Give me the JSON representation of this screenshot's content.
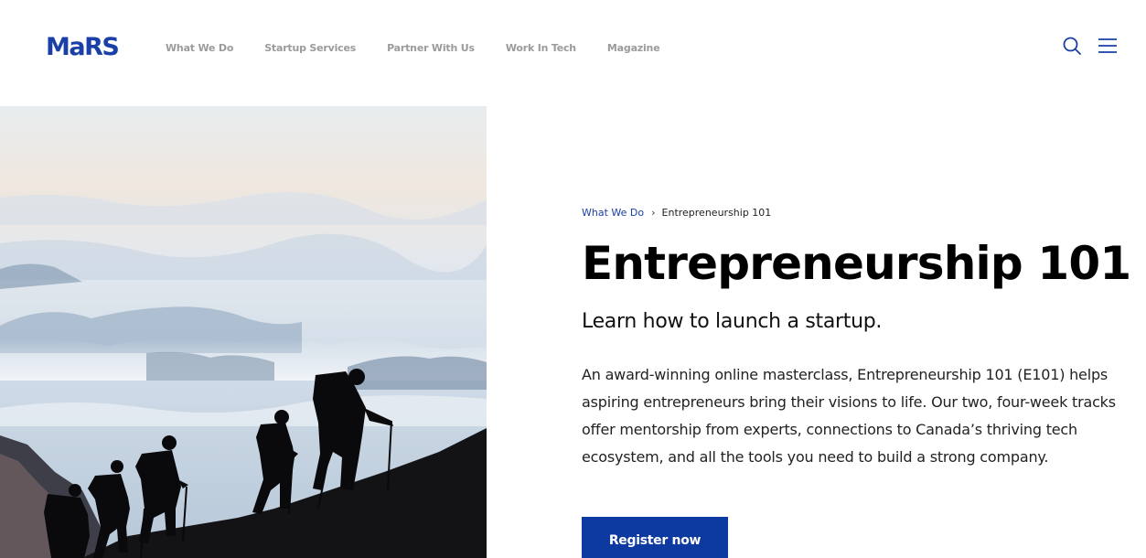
{
  "header": {
    "logo": "MaRS",
    "nav": [
      "What We Do",
      "Startup Services",
      "Partner With Us",
      "Work In Tech",
      "Magazine"
    ],
    "search_icon": "search-icon",
    "menu_icon": "hamburger-menu-icon"
  },
  "hero": {
    "image": "hikers-silhouette-mountains-photo"
  },
  "breadcrumb": {
    "parent": "What We Do",
    "separator_icon": "chevron-right-icon",
    "current": "Entrepreneurship 101"
  },
  "main": {
    "title": "Entrepreneurship 101",
    "subtitle": "Learn how to launch a startup.",
    "description": "An award-winning online masterclass, Entrepreneurship 101 (E101) helps aspiring entrepreneurs bring their visions to life. Our two, four-week tracks offer mentorship from experts, connections to Canada’s thriving tech ecosystem, and all the tools you need to build a strong company.",
    "cta_label": "Register now"
  },
  "colors": {
    "brand": "#1a3fa6",
    "cta": "#0d3aa0",
    "nav_text": "#9b9b9b"
  }
}
